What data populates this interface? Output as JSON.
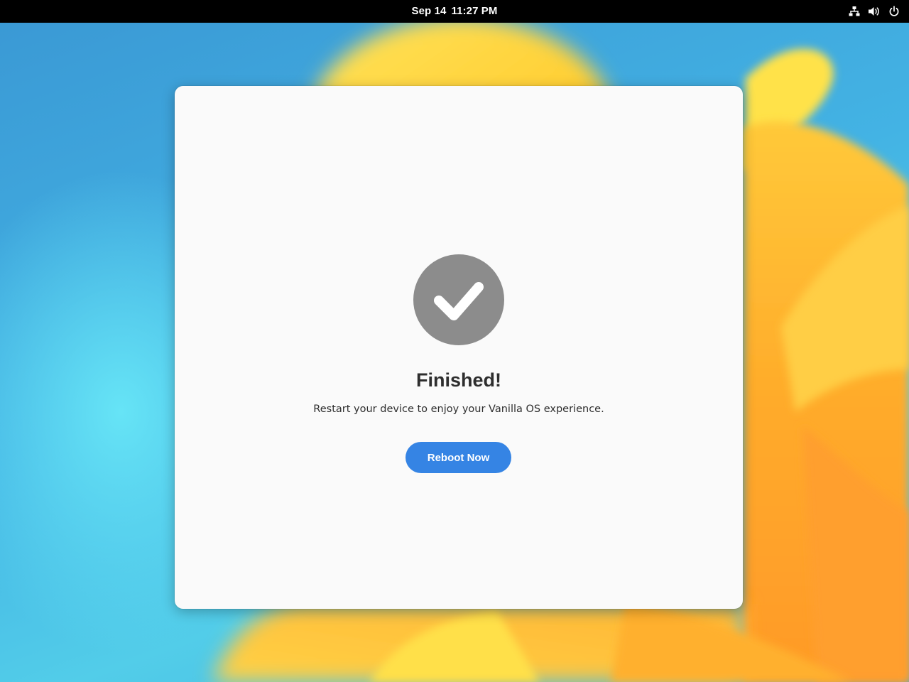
{
  "topbar": {
    "date": "Sep 14",
    "time": "11:27 PM",
    "tray_icons": [
      "network-wired-icon",
      "volume-icon",
      "power-icon"
    ]
  },
  "dialog": {
    "status_icon": "checkmark-circle-icon",
    "title": "Finished!",
    "description": "Restart your device to enjoy your Vanilla OS experience.",
    "primary_button_label": "Reboot Now"
  },
  "colors": {
    "topbar_bg": "#000000",
    "window_bg": "#fafafa",
    "accent": "#3584e4",
    "status_icon": "#8c8c8c",
    "text": "#2e2e2e"
  }
}
